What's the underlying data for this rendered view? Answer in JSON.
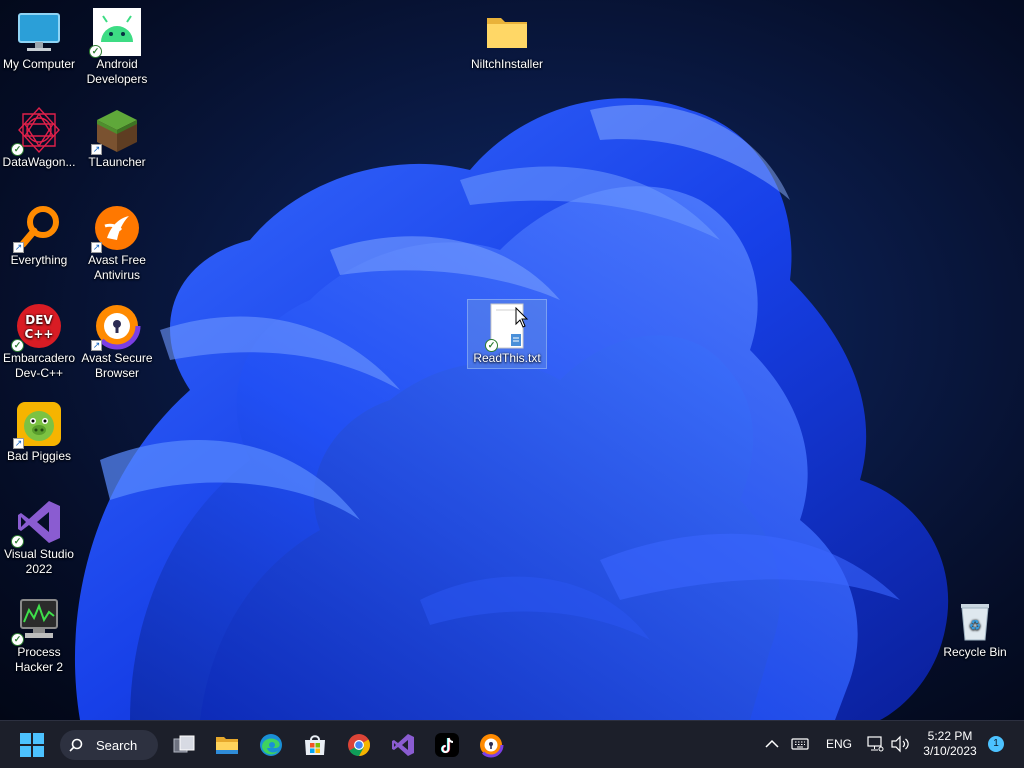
{
  "desktop": {
    "icons": [
      {
        "label": "My Computer",
        "icon": "monitor-icon"
      },
      {
        "label": "Android Developers",
        "icon": "android-icon"
      },
      {
        "label": "NiltchInstaller",
        "icon": "folder-icon"
      },
      {
        "label": "DataWagon...",
        "icon": "datawagon-icon"
      },
      {
        "label": "TLauncher",
        "icon": "grass-block-icon"
      },
      {
        "label": "Everything",
        "icon": "magnifier-icon"
      },
      {
        "label": "Avast Free Antivirus",
        "icon": "avast-icon"
      },
      {
        "label": "Embarcadero Dev-C++",
        "icon": "devcpp-icon"
      },
      {
        "label": "Avast Secure Browser",
        "icon": "avast-browser-icon"
      },
      {
        "label": "ReadThis.txt",
        "icon": "text-file-icon"
      },
      {
        "label": "Bad Piggies",
        "icon": "bad-piggies-icon"
      },
      {
        "label": "Visual Studio 2022",
        "icon": "visual-studio-icon"
      },
      {
        "label": "Process Hacker 2",
        "icon": "process-hacker-icon"
      },
      {
        "label": "Recycle Bin",
        "icon": "recycle-bin-icon"
      }
    ]
  },
  "taskbar": {
    "search_label": "Search",
    "pinned": [
      {
        "name": "start-button",
        "icon": "windows-logo-icon"
      },
      {
        "name": "task-view-button",
        "icon": "task-view-icon"
      },
      {
        "name": "file-explorer-button",
        "icon": "file-explorer-icon"
      },
      {
        "name": "edge-button",
        "icon": "edge-icon"
      },
      {
        "name": "store-button",
        "icon": "microsoft-store-icon"
      },
      {
        "name": "chrome-button",
        "icon": "chrome-icon"
      },
      {
        "name": "visual-studio-button",
        "icon": "visual-studio-icon"
      },
      {
        "name": "tiktok-button",
        "icon": "tiktok-icon"
      },
      {
        "name": "avast-browser-button",
        "icon": "avast-browser-icon"
      }
    ],
    "tray": {
      "language": "ENG",
      "time": "5:22 PM",
      "date": "3/10/2023",
      "notification_count": "1"
    }
  },
  "colors": {
    "taskbar_bg": "#1c1f2a",
    "accent": "#4cc2ff",
    "wallpaper_blue": "#1f4dff"
  }
}
